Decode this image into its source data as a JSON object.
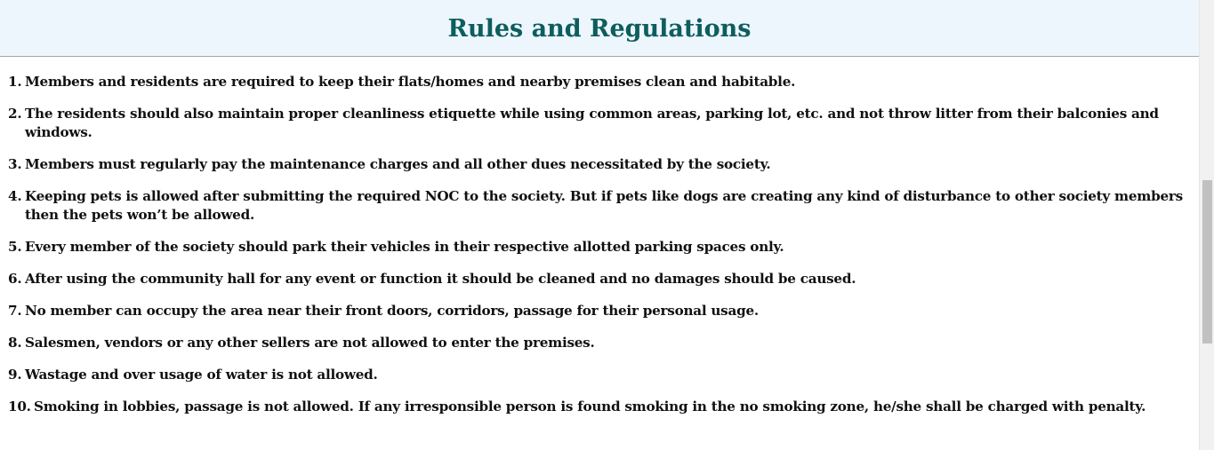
{
  "page": {
    "title": "Rules and Regulations"
  },
  "rules": [
    {
      "num": "1.",
      "text": "Members and residents are required to keep their flats/homes and nearby premises clean and habitable."
    },
    {
      "num": "2.",
      "text": "The residents should also maintain proper cleanliness etiquette while using common areas, parking lot, etc. and not throw litter from their balconies and windows."
    },
    {
      "num": "3.",
      "text": "Members must regularly pay the maintenance charges and all other dues necessitated by the society."
    },
    {
      "num": "4.",
      "text": "Keeping pets is allowed after submitting the required NOC to the society. But if pets like dogs are creating any kind of disturbance to other society members then the pets won’t be allowed."
    },
    {
      "num": "5.",
      "text": "Every member of the society should park their vehicles in their respective allotted parking spaces only."
    },
    {
      "num": "6.",
      "text": "After using the community hall for any event or function it should be cleaned and no damages should be caused."
    },
    {
      "num": "7.",
      "text": "No member can occupy the area near their front doors, corridors, passage for their personal usage."
    },
    {
      "num": "8.",
      "text": "Salesmen, vendors or any other sellers are not allowed to enter the premises."
    },
    {
      "num": "9.",
      "text": "Wastage and over usage of water is not allowed."
    },
    {
      "num": "10.",
      "text": "Smoking in lobbies, passage is not allowed. If any irresponsible person is found smoking in the no smoking zone, he/she shall be charged with penalty."
    }
  ]
}
